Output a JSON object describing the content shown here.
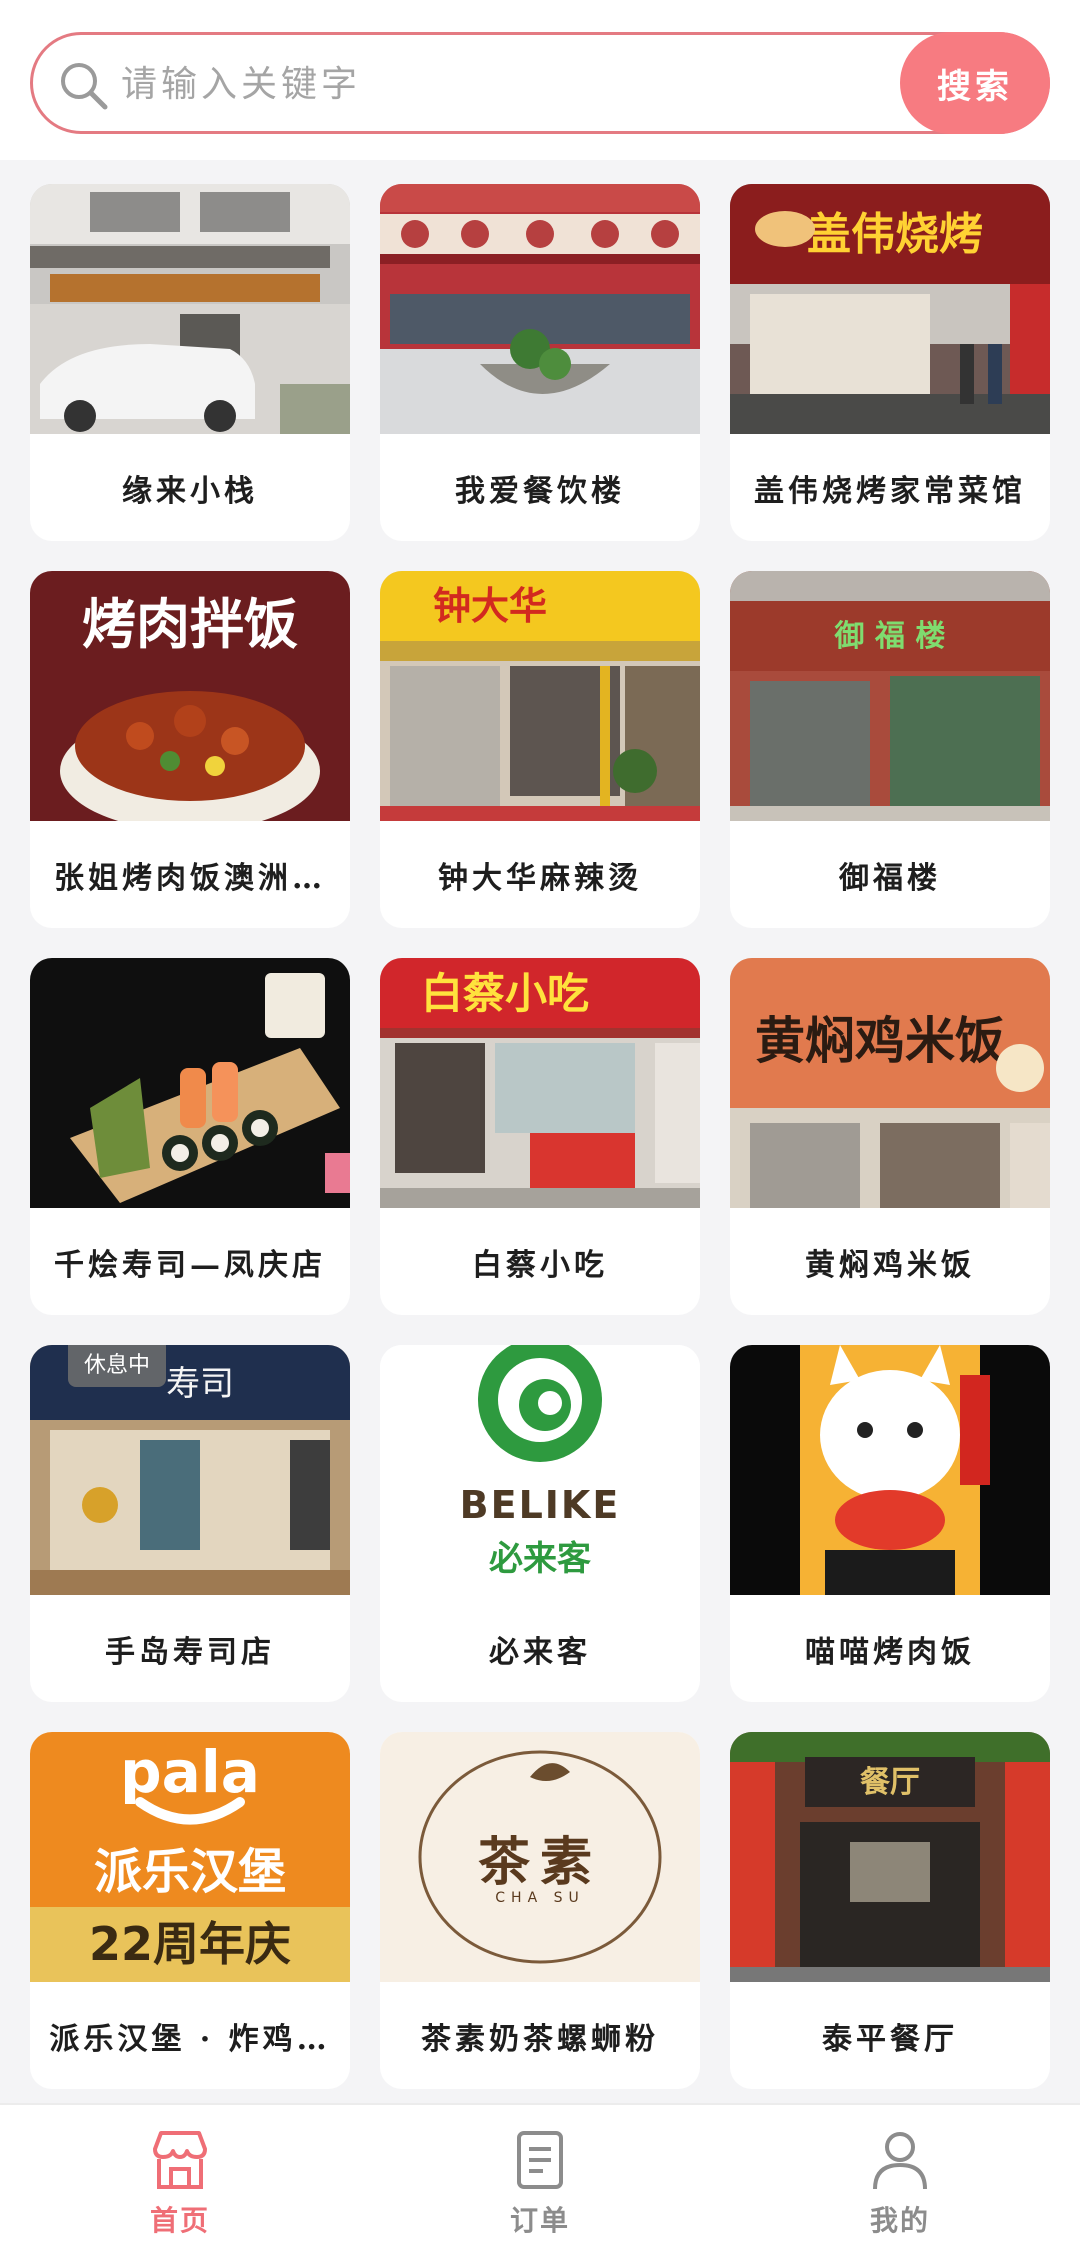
{
  "search": {
    "placeholder": "请输入关键字",
    "button_label": "搜索"
  },
  "colors": {
    "accent": "#f77b81",
    "search_border": "#e47a82",
    "tab_active": "#ef6e76",
    "tab_inactive": "#8c8c8c",
    "background": "#f4f4f6"
  },
  "restaurants": [
    {
      "name": "缘来小栈",
      "image": "storefront-photo"
    },
    {
      "name": "我爱餐饮楼",
      "image": "storefront-photo"
    },
    {
      "name": "盖伟烧烤家常菜馆",
      "image": "storefront-photo"
    },
    {
      "name": "张姐烤肉饭澳洲…",
      "image": "food-photo"
    },
    {
      "name": "钟大华麻辣烫",
      "image": "storefront-photo"
    },
    {
      "name": "御福楼",
      "image": "storefront-photo"
    },
    {
      "name": "千烩寿司—凤庆店",
      "image": "food-photo"
    },
    {
      "name": "白蔡小吃",
      "image": "storefront-photo"
    },
    {
      "name": "黄焖鸡米饭",
      "image": "storefront-photo"
    },
    {
      "name": "手岛寿司店",
      "image": "storefront-photo",
      "badge": "休息中"
    },
    {
      "name": "必来客",
      "image": "logo",
      "logo_text": "BELIKE",
      "logo_subtext": "必来客"
    },
    {
      "name": "喵喵烤肉饭",
      "image": "logo"
    },
    {
      "name": "派乐汉堡 · 炸鸡…",
      "image": "logo",
      "logo_text": "pala",
      "logo_subtext": "派乐汉堡",
      "logo_tagline": "22周年庆"
    },
    {
      "name": "茶素奶茶螺蛳粉",
      "image": "logo",
      "logo_text": "茶素",
      "logo_subtext": "CHA SU"
    },
    {
      "name": "泰平餐厅",
      "image": "storefront-photo"
    }
  ],
  "tabbar": {
    "items": [
      {
        "label": "首页",
        "icon": "store-icon",
        "active": true
      },
      {
        "label": "订单",
        "icon": "order-list-icon",
        "active": false
      },
      {
        "label": "我的",
        "icon": "user-icon",
        "active": false
      }
    ]
  }
}
